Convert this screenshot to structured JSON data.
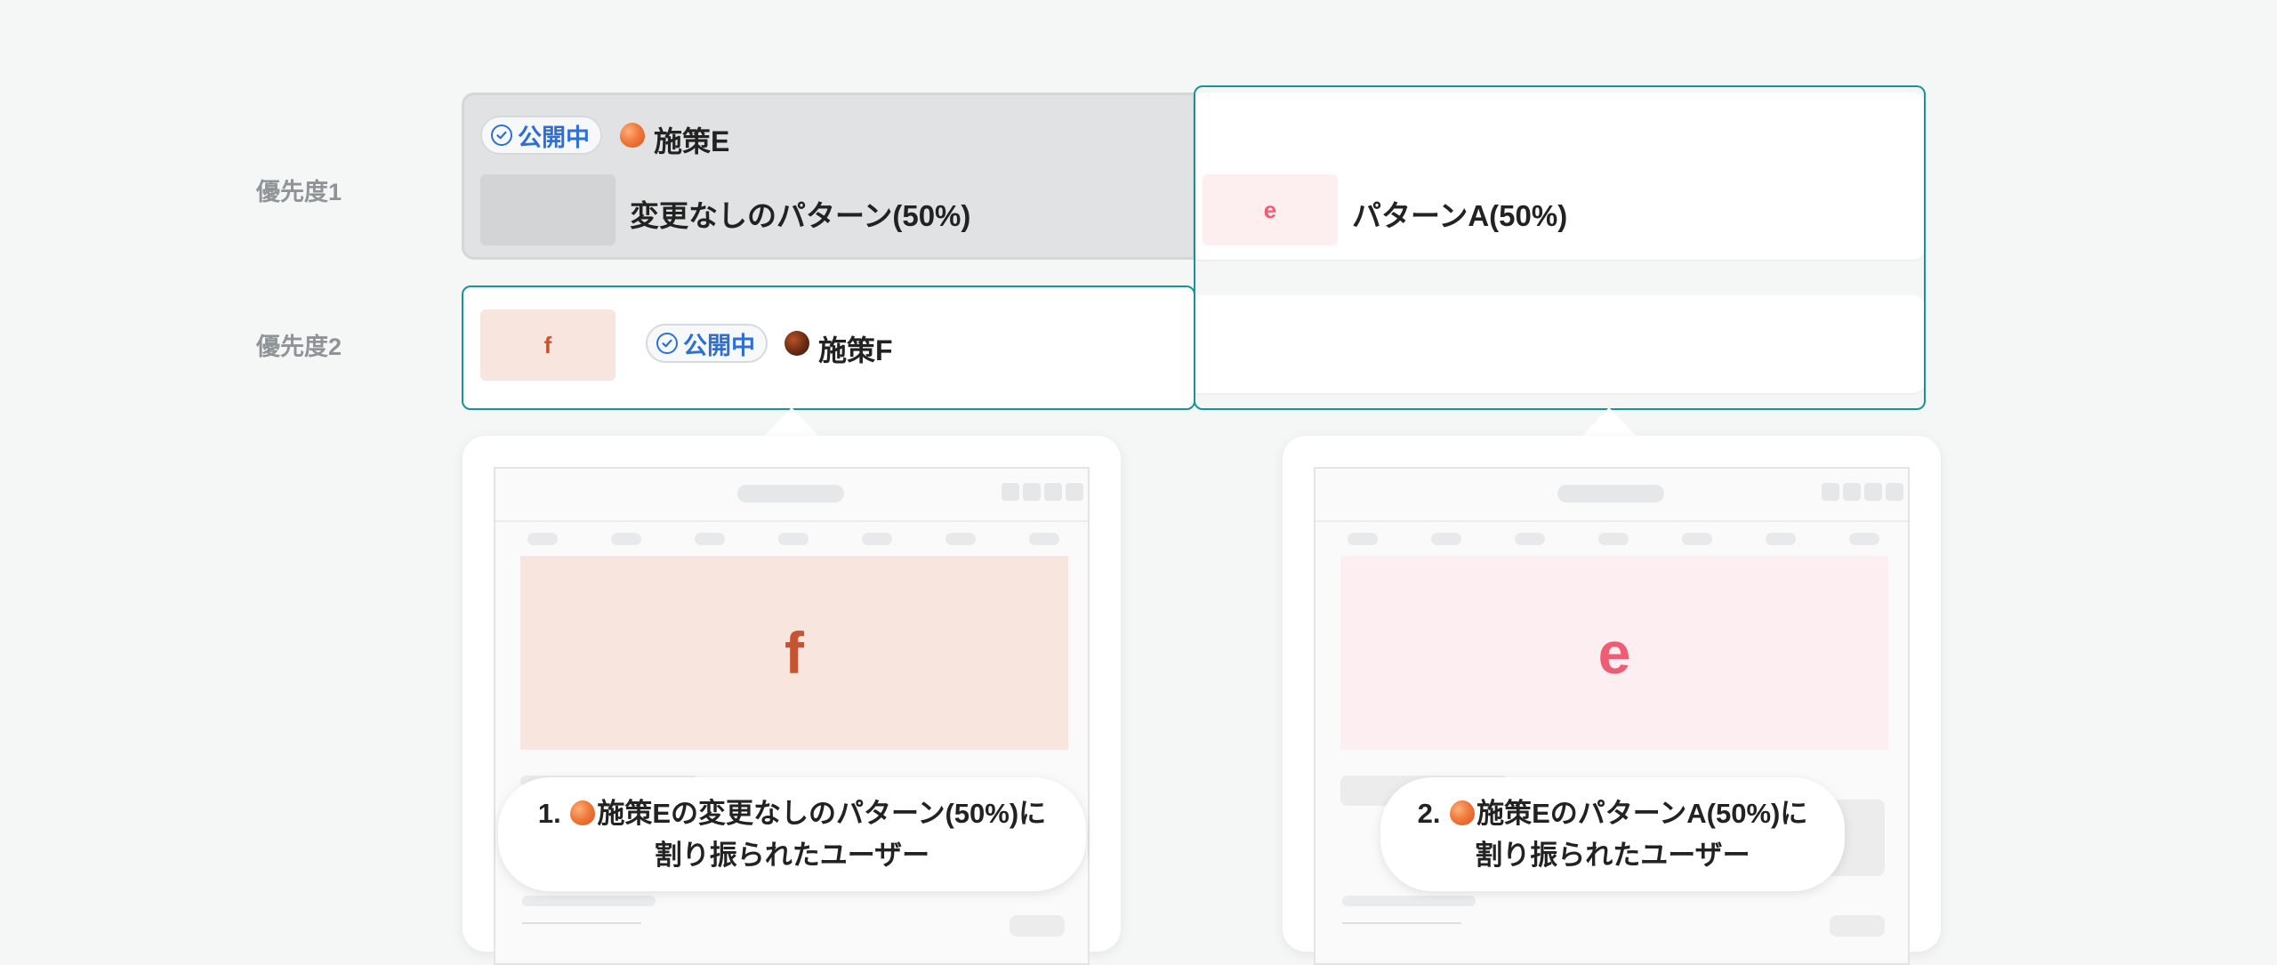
{
  "priorities": [
    {
      "label": "優先度1"
    },
    {
      "label": "優先度2"
    }
  ],
  "campaign_e": {
    "status": "公開中",
    "name": "施策E",
    "patterns": [
      {
        "label": "変更なしのパターン(50%)",
        "thumb": ""
      },
      {
        "label": "パターンA(50%)",
        "thumb": "e"
      }
    ]
  },
  "campaign_f": {
    "status": "公開中",
    "name": "施策F",
    "thumb": "f"
  },
  "previews": [
    {
      "hero_letter": "f",
      "number": "1.",
      "caption_line1": "施策Eの変更なしのパターン(50%)に",
      "caption_line2": "割り振られたユーザー"
    },
    {
      "hero_letter": "e",
      "number": "2.",
      "caption_line1": "施策EのパターンA(50%)に",
      "caption_line2": "割り振られたユーザー"
    }
  ],
  "colors": {
    "accent_teal": "#18939a",
    "status_blue": "#2d6fd6",
    "pattern_e": "#ee5d73",
    "pattern_f": "#c65433"
  },
  "icons": [
    "check-circle-icon",
    "peach-icon",
    "dark-peach-icon"
  ]
}
